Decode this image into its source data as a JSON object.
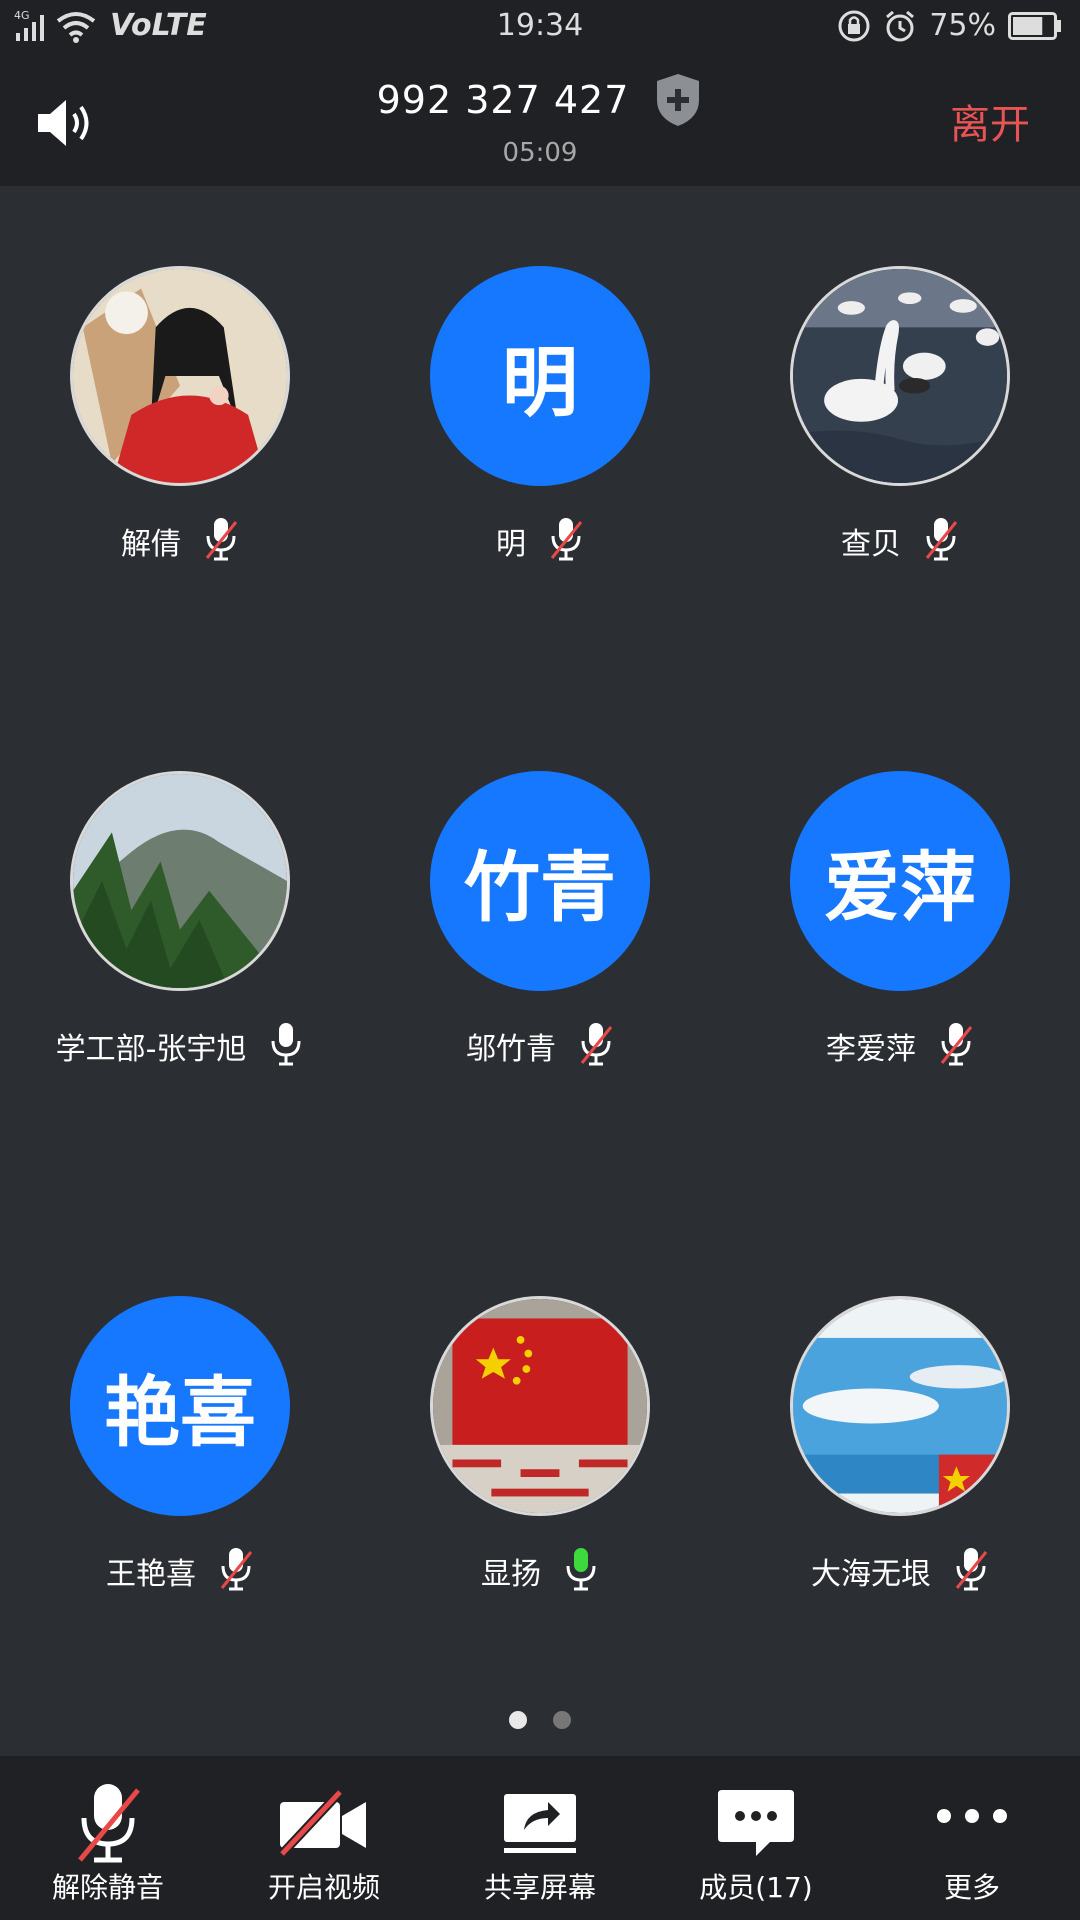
{
  "status_bar": {
    "network": "4G",
    "volte": "VoLTE",
    "time": "19:34",
    "battery": "75%"
  },
  "header": {
    "meeting_id": "992 327 427",
    "duration": "05:09",
    "leave_label": "离开"
  },
  "participants": [
    {
      "name": "解倩",
      "avatar_text": "",
      "avatar_type": "photo-girl",
      "mic": "muted"
    },
    {
      "name": "明",
      "avatar_text": "明",
      "avatar_type": "text",
      "mic": "muted"
    },
    {
      "name": "查贝",
      "avatar_text": "",
      "avatar_type": "photo-swans",
      "mic": "muted"
    },
    {
      "name": "学工部-张宇旭",
      "avatar_text": "",
      "avatar_type": "photo-mountain",
      "mic": "on"
    },
    {
      "name": "邬竹青",
      "avatar_text": "竹青",
      "avatar_type": "text",
      "mic": "muted"
    },
    {
      "name": "李爱萍",
      "avatar_text": "爱萍",
      "avatar_type": "text",
      "mic": "muted"
    },
    {
      "name": "王艳喜",
      "avatar_text": "艳喜",
      "avatar_type": "text",
      "mic": "muted"
    },
    {
      "name": "显扬",
      "avatar_text": "",
      "avatar_type": "photo-flag",
      "mic": "speaking"
    },
    {
      "name": "大海无垠",
      "avatar_text": "",
      "avatar_type": "photo-sea",
      "mic": "muted"
    }
  ],
  "pager": {
    "current": 1,
    "total": 2
  },
  "toolbar": {
    "unmute_label": "解除静音",
    "video_label": "开启视频",
    "share_label": "共享屏幕",
    "members_label": "成员(17)",
    "more_label": "更多"
  },
  "colors": {
    "background": "#2b2e33",
    "bar": "#1f2124",
    "avatar_blue": "#1677ff",
    "leave_red": "#e85454",
    "mute_red": "#e84848",
    "speaking_green": "#3dd93d"
  }
}
